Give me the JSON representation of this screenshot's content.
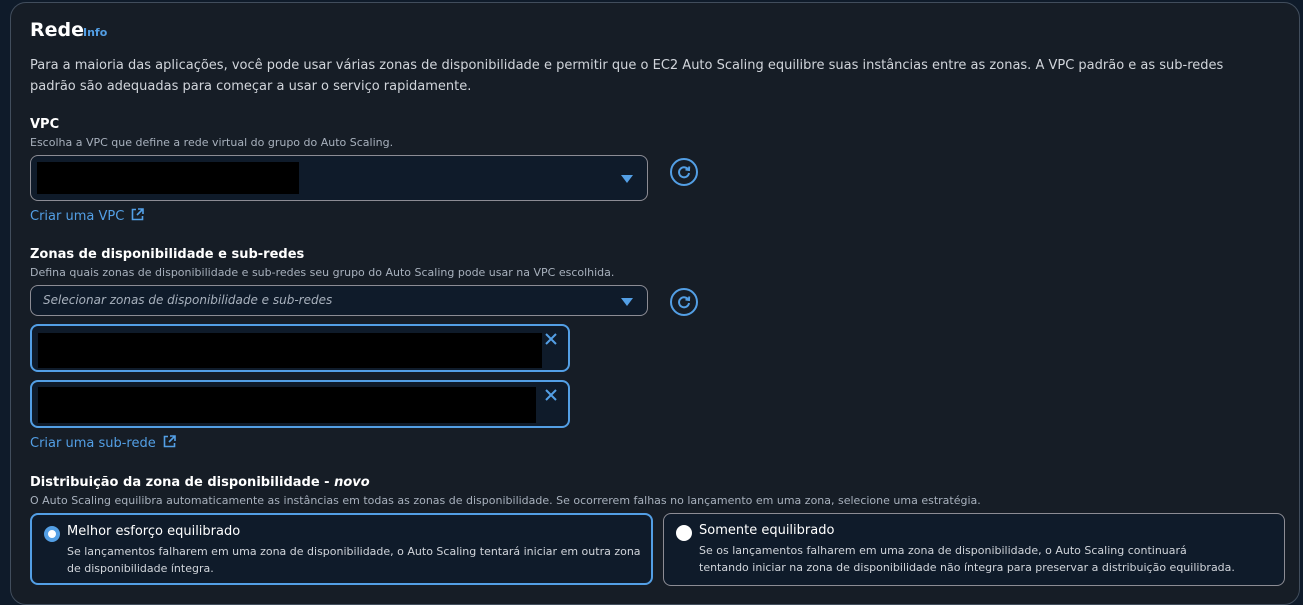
{
  "section": {
    "title": "Rede",
    "info_link": "Info",
    "description": "Para a maioria das aplicações, você pode usar várias zonas de disponibilidade e permitir que o EC2 Auto Scaling equilibre suas instâncias entre as zonas. A VPC padrão e as sub-redes padrão são adequadas para começar a usar o serviço rapidamente."
  },
  "vpc": {
    "label": "VPC",
    "description": "Escolha a VPC que define a rede virtual do grupo do Auto Scaling.",
    "create_link": "Criar uma VPC"
  },
  "zones": {
    "label": "Zonas de disponibilidade e sub-redes",
    "description": "Defina quais zonas de disponibilidade e sub-redes seu grupo do Auto Scaling pode usar na VPC escolhida.",
    "placeholder": "Selecionar zonas de disponibilidade e sub-redes",
    "create_link": "Criar uma sub-rede"
  },
  "distribution": {
    "label": "Distribuição da zona de disponibilidade - ",
    "label_new": "novo",
    "description": "O Auto Scaling equilibra automaticamente as instâncias em todas as zonas de disponibilidade. Se ocorrerem falhas no lançamento em uma zona, selecione uma estratégia.",
    "options": [
      {
        "title": "Melhor esforço equilibrado",
        "description": "Se lançamentos falharem em uma zona de disponibilidade, o Auto Scaling tentará iniciar em outra zona de disponibilidade íntegra.",
        "selected": true
      },
      {
        "title": "Somente equilibrado",
        "description": "Se os lançamentos falharem em uma zona de disponibilidade, o Auto Scaling continuará tentando iniciar na zona de disponibilidade não íntegra para preservar a distribuição equilibrada.",
        "selected": false
      }
    ]
  },
  "colors": {
    "accent": "#539fe5",
    "panel": "#161d26",
    "background": "#0f1b2a"
  },
  "icons": [
    "refresh-icon",
    "external-link-icon",
    "close-icon",
    "chevron-down-icon"
  ]
}
